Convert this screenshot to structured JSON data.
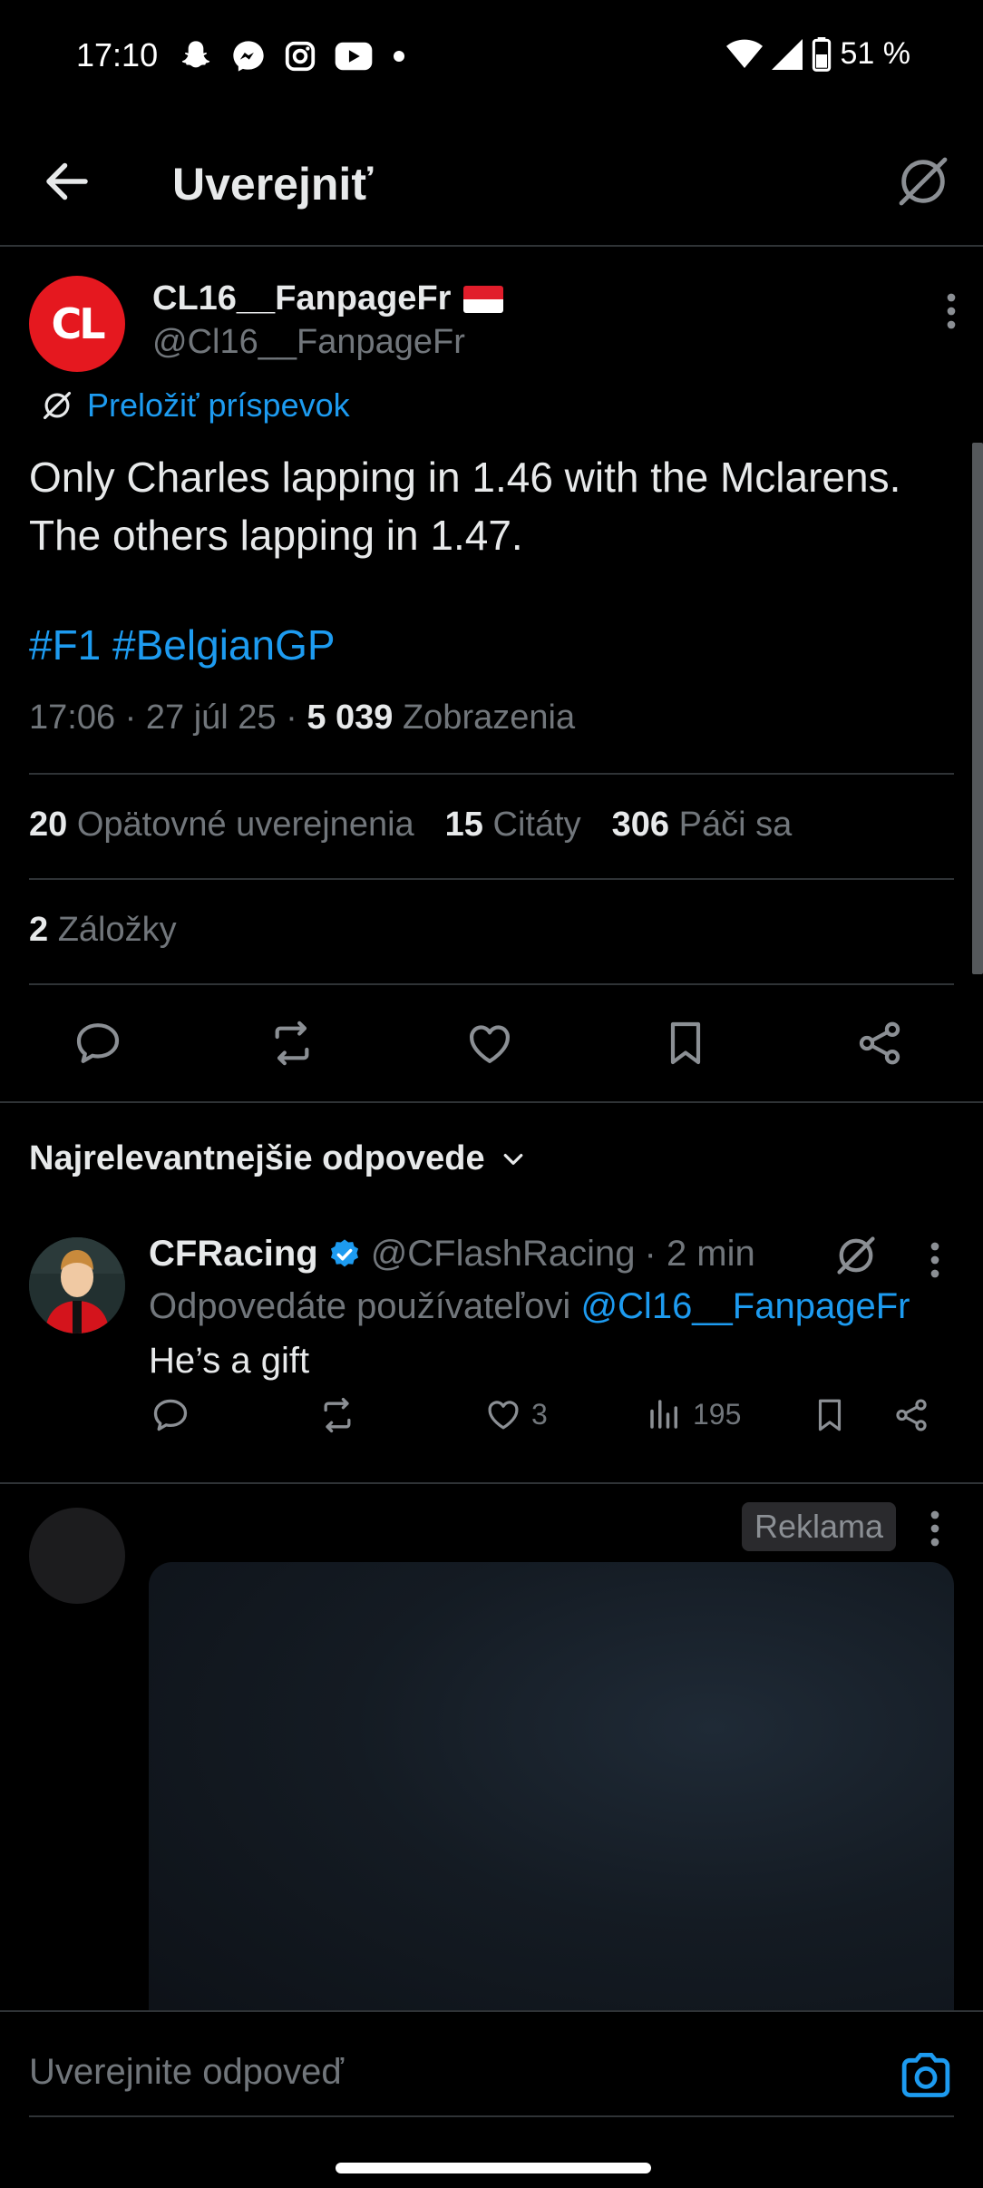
{
  "status_bar": {
    "time": "17:10",
    "battery": "51 %"
  },
  "header": {
    "title": "Uverejniť"
  },
  "post": {
    "display_name": "CL16__FanpageFr",
    "handle": "@Cl16__FanpageFr",
    "avatar_text": "CL",
    "translate_label": "Preložiť príspevok",
    "text": "Only Charles lapping in 1.46 with the Mclarens. The others lapping in 1.47.",
    "hashtags": "#F1 #BelgianGP",
    "timestamp": "17:06 · 27 júl 25 · ",
    "views_count": "5 039",
    "views_label": " Zobrazenia",
    "reposts_count": "20",
    "reposts_label": "Opätovné uverejnenia",
    "quotes_count": "15",
    "quotes_label": "Citáty",
    "likes_count": "306",
    "likes_label": "Páči sa",
    "bookmarks_count": "2",
    "bookmarks_label": "Záložky"
  },
  "replies": {
    "sort_label": "Najrelevantnejšie odpovede",
    "items": [
      {
        "name": "CFRacing",
        "handle": "@CFlashRacing",
        "time": "· 2 min",
        "replying_to_prefix": "Odpovedáte používateľovi ",
        "replying_to_handle": "@Cl16__FanpageFr",
        "text": "He’s a gift",
        "likes": "3",
        "views": "195"
      }
    ]
  },
  "ad": {
    "badge": "Reklama"
  },
  "composer": {
    "placeholder": "Uverejnite odpoveď"
  },
  "colors": {
    "accent": "#1d9bf0",
    "muted": "#71767b",
    "text": "#e7e9ea",
    "divider": "#2f3336",
    "avatar_red": "#e5181f"
  }
}
